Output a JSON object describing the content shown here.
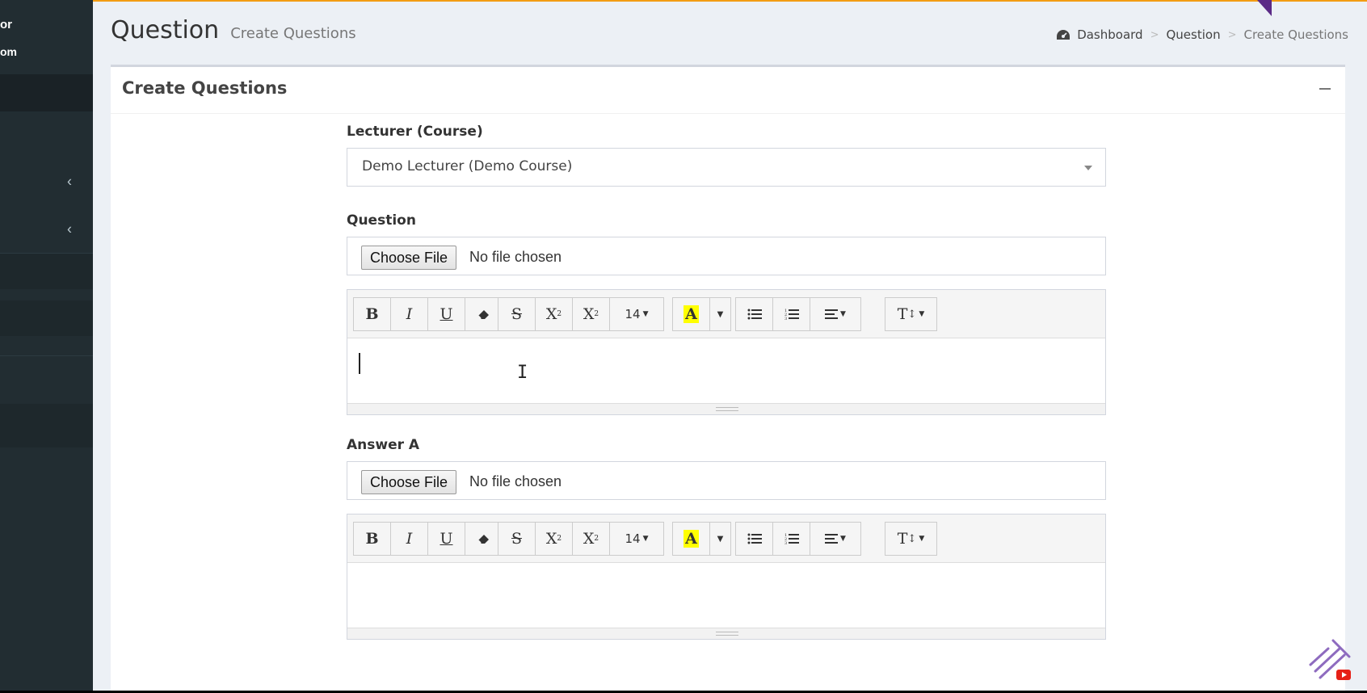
{
  "sidebar": {
    "user_line1": "or",
    "user_line2": "om",
    "chevrons": [
      "‹",
      "‹"
    ]
  },
  "header": {
    "title": "Question",
    "subtitle": "Create Questions",
    "breadcrumb": [
      "Dashboard",
      "Question",
      "Create Questions"
    ],
    "breadcrumb_sep": ">"
  },
  "box": {
    "title": "Create Questions",
    "collapse_icon": "minus-icon"
  },
  "form": {
    "lecturer_label": "Lecturer (Course)",
    "lecturer_value": "Demo Lecturer (Demo Course)",
    "question_label": "Question",
    "answer_a_label": "Answer A",
    "file_button": "Choose File",
    "file_status": "No file chosen",
    "font_size": "14"
  },
  "toolbar": {
    "bold": "B",
    "italic": "I",
    "underline": "U",
    "strike": "S",
    "superscript": "X",
    "subscript": "X",
    "highlight": "A",
    "font_size_label": "14",
    "text_style": "T"
  },
  "colors": {
    "sidebar_bg": "#222d32",
    "accent_top": "#f39c12",
    "highlight": "#ffff00",
    "page_bg": "#ecf0f5"
  }
}
